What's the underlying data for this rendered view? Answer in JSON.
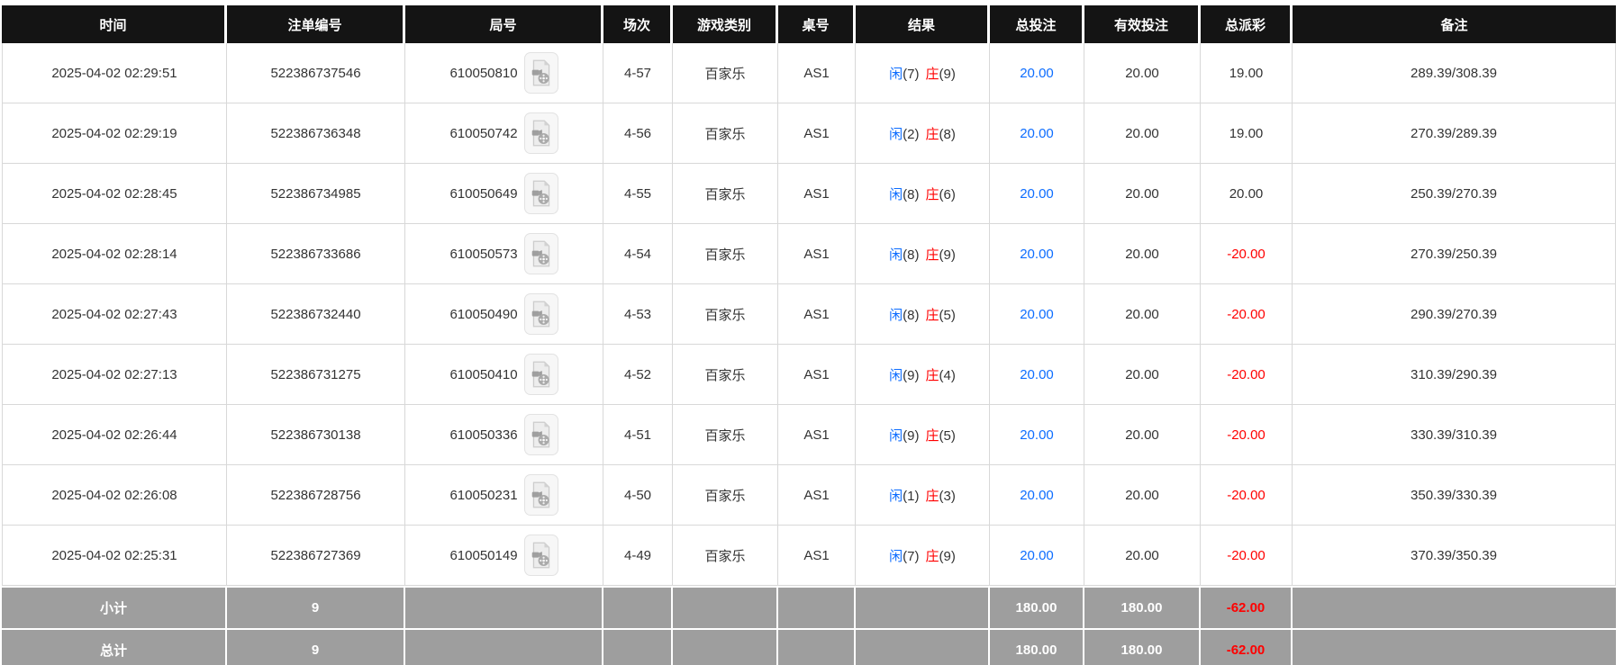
{
  "header": {
    "columns": [
      "时间",
      "注单编号",
      "局号",
      "场次",
      "游戏类别",
      "桌号",
      "结果",
      "总投注",
      "有效投注",
      "总派彩",
      "备注"
    ]
  },
  "rows": [
    {
      "time": "2025-04-02 02:29:51",
      "bet_no": "522386737546",
      "round_no": "610050810",
      "session": "4-57",
      "game": "百家乐",
      "table_no": "AS1",
      "player_label": "闲",
      "player_score": "(7)",
      "banker_label": "庄",
      "banker_score": "(9)",
      "total_bet": "20.00",
      "valid_bet": "20.00",
      "payout": "19.00",
      "remark": "289.39/308.39"
    },
    {
      "time": "2025-04-02 02:29:19",
      "bet_no": "522386736348",
      "round_no": "610050742",
      "session": "4-56",
      "game": "百家乐",
      "table_no": "AS1",
      "player_label": "闲",
      "player_score": "(2)",
      "banker_label": "庄",
      "banker_score": "(8)",
      "total_bet": "20.00",
      "valid_bet": "20.00",
      "payout": "19.00",
      "remark": "270.39/289.39"
    },
    {
      "time": "2025-04-02 02:28:45",
      "bet_no": "522386734985",
      "round_no": "610050649",
      "session": "4-55",
      "game": "百家乐",
      "table_no": "AS1",
      "player_label": "闲",
      "player_score": "(8)",
      "banker_label": "庄",
      "banker_score": "(6)",
      "total_bet": "20.00",
      "valid_bet": "20.00",
      "payout": "20.00",
      "remark": "250.39/270.39"
    },
    {
      "time": "2025-04-02 02:28:14",
      "bet_no": "522386733686",
      "round_no": "610050573",
      "session": "4-54",
      "game": "百家乐",
      "table_no": "AS1",
      "player_label": "闲",
      "player_score": "(8)",
      "banker_label": "庄",
      "banker_score": "(9)",
      "total_bet": "20.00",
      "valid_bet": "20.00",
      "payout": "-20.00",
      "remark": "270.39/250.39"
    },
    {
      "time": "2025-04-02 02:27:43",
      "bet_no": "522386732440",
      "round_no": "610050490",
      "session": "4-53",
      "game": "百家乐",
      "table_no": "AS1",
      "player_label": "闲",
      "player_score": "(8)",
      "banker_label": "庄",
      "banker_score": "(5)",
      "total_bet": "20.00",
      "valid_bet": "20.00",
      "payout": "-20.00",
      "remark": "290.39/270.39"
    },
    {
      "time": "2025-04-02 02:27:13",
      "bet_no": "522386731275",
      "round_no": "610050410",
      "session": "4-52",
      "game": "百家乐",
      "table_no": "AS1",
      "player_label": "闲",
      "player_score": "(9)",
      "banker_label": "庄",
      "banker_score": "(4)",
      "total_bet": "20.00",
      "valid_bet": "20.00",
      "payout": "-20.00",
      "remark": "310.39/290.39"
    },
    {
      "time": "2025-04-02 02:26:44",
      "bet_no": "522386730138",
      "round_no": "610050336",
      "session": "4-51",
      "game": "百家乐",
      "table_no": "AS1",
      "player_label": "闲",
      "player_score": "(9)",
      "banker_label": "庄",
      "banker_score": "(5)",
      "total_bet": "20.00",
      "valid_bet": "20.00",
      "payout": "-20.00",
      "remark": "330.39/310.39"
    },
    {
      "time": "2025-04-02 02:26:08",
      "bet_no": "522386728756",
      "round_no": "610050231",
      "session": "4-50",
      "game": "百家乐",
      "table_no": "AS1",
      "player_label": "闲",
      "player_score": "(1)",
      "banker_label": "庄",
      "banker_score": "(3)",
      "total_bet": "20.00",
      "valid_bet": "20.00",
      "payout": "-20.00",
      "remark": "350.39/330.39"
    },
    {
      "time": "2025-04-02 02:25:31",
      "bet_no": "522386727369",
      "round_no": "610050149",
      "session": "4-49",
      "game": "百家乐",
      "table_no": "AS1",
      "player_label": "闲",
      "player_score": "(7)",
      "banker_label": "庄",
      "banker_score": "(9)",
      "total_bet": "20.00",
      "valid_bet": "20.00",
      "payout": "-20.00",
      "remark": "370.39/350.39"
    }
  ],
  "footer": [
    {
      "label": "小计",
      "count": "9",
      "total_bet": "180.00",
      "valid_bet": "180.00",
      "payout": "-62.00"
    },
    {
      "label": "总计",
      "count": "9",
      "total_bet": "180.00",
      "valid_bet": "180.00",
      "payout": "-62.00"
    }
  ],
  "colors": {
    "header_bg": "#141414",
    "footer_bg": "#9e9e9e",
    "accent_blue": "#0d6dff",
    "accent_red": "#ff0000",
    "grid_line": "#d8d8d8"
  },
  "icons": {
    "video_replay": "video-file-icon"
  }
}
